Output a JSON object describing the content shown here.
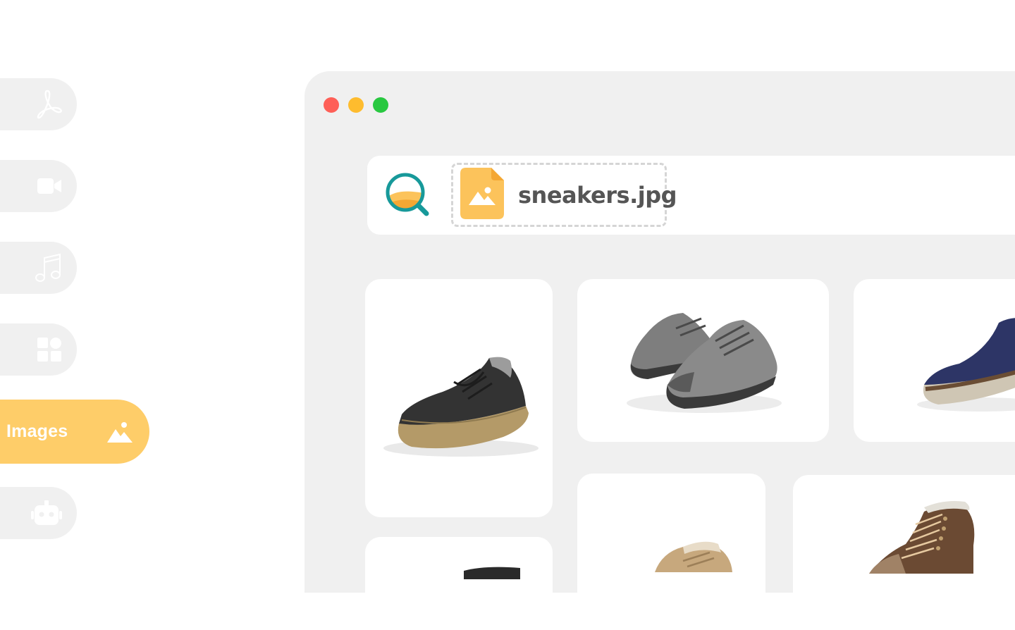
{
  "sidebar": {
    "items": [
      {
        "id": "pdf",
        "icon": "pdf-icon"
      },
      {
        "id": "video",
        "icon": "video-camera-icon"
      },
      {
        "id": "audio",
        "icon": "music-note-icon"
      },
      {
        "id": "apps",
        "icon": "apps-grid-icon"
      },
      {
        "id": "images",
        "label": "Images",
        "icon": "image-icon",
        "active": true
      },
      {
        "id": "ai",
        "icon": "robot-icon"
      }
    ]
  },
  "window": {
    "controls": [
      "close",
      "minimize",
      "maximize"
    ]
  },
  "search": {
    "icon": "search-icon",
    "file_chip": {
      "icon": "image-file-icon",
      "filename": "sneakers.jpg"
    }
  },
  "results": [
    {
      "item": "black-suede-sneaker"
    },
    {
      "item": "grey-canvas-sneakers-pair"
    },
    {
      "item": "navy-slip-on-shoe"
    },
    {
      "item": "black-sneaker"
    },
    {
      "item": "tan-sneaker"
    },
    {
      "item": "brown-hiking-boot"
    }
  ],
  "colors": {
    "accent": "#fecd69",
    "accent_dark": "#f4a733",
    "search_teal": "#17999a",
    "panel_bg": "#f0f0f0",
    "window_close": "#fe5f57",
    "window_minimize": "#febc2e",
    "window_maximize": "#28c840"
  }
}
